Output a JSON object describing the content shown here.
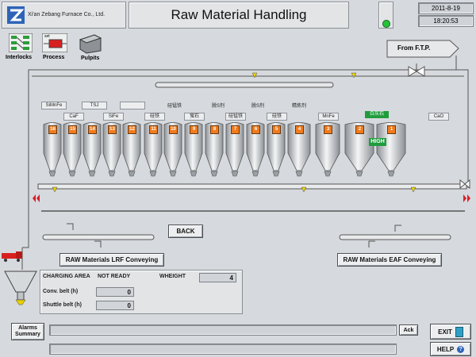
{
  "header": {
    "company": "Xi'an Zebang Furnace Co., Ltd.",
    "title": "Raw Material Handling",
    "date": "2011-8-19",
    "time": "18:20:53",
    "status_color": "#25c23a"
  },
  "toolbar": {
    "interlocks": "Interlocks",
    "process": "Process",
    "pulpits": "Pulpits",
    "process_set": "set"
  },
  "from_ftp": "From F.T.P.",
  "top_labels": {
    "simnfe": "SiMnFe",
    "tsj": "TSJ",
    "blank": "",
    "caf": "CaF",
    "sife": "SiFe",
    "g1": "硅锰铁",
    "g2": "脱S剂",
    "g3": "脱S剂",
    "g4": "精炼剂",
    "g5": "硅铁",
    "g6": "萤石",
    "g7": "硅锰铁",
    "g8": "硅铁",
    "mnfe": "MnFe",
    "lime": "白灰石",
    "cao": "CaO"
  },
  "bins": [
    "16",
    "15",
    "14",
    "13",
    "12",
    "11",
    "10",
    "9",
    "8",
    "7",
    "6",
    "5",
    "4",
    "3",
    "2",
    "1"
  ],
  "high_label": "HIGH",
  "buttons": {
    "back": "BACK",
    "lrf": "RAW Materials LRF Conveying",
    "eaf": "RAW Materials EAF Conveying",
    "ack": "Ack",
    "exit": "EXIT",
    "help": "HELP",
    "alarms": "Alarms Summary"
  },
  "charging": {
    "area_label": "CHARGING AREA",
    "area_value": "NOT READY",
    "weight_label": "WHEIGHT",
    "weight_value": "4",
    "conv_label": "Conv. belt (h)",
    "conv_value": "0",
    "shuttle_label": "Shuttle belt (h)",
    "shuttle_value": "0"
  },
  "colors": {
    "bin_number": "#f27a1b",
    "high_tag": "#1f9c3c",
    "arrow_red": "#d8202a",
    "valve_yellow": "#e8d000"
  }
}
